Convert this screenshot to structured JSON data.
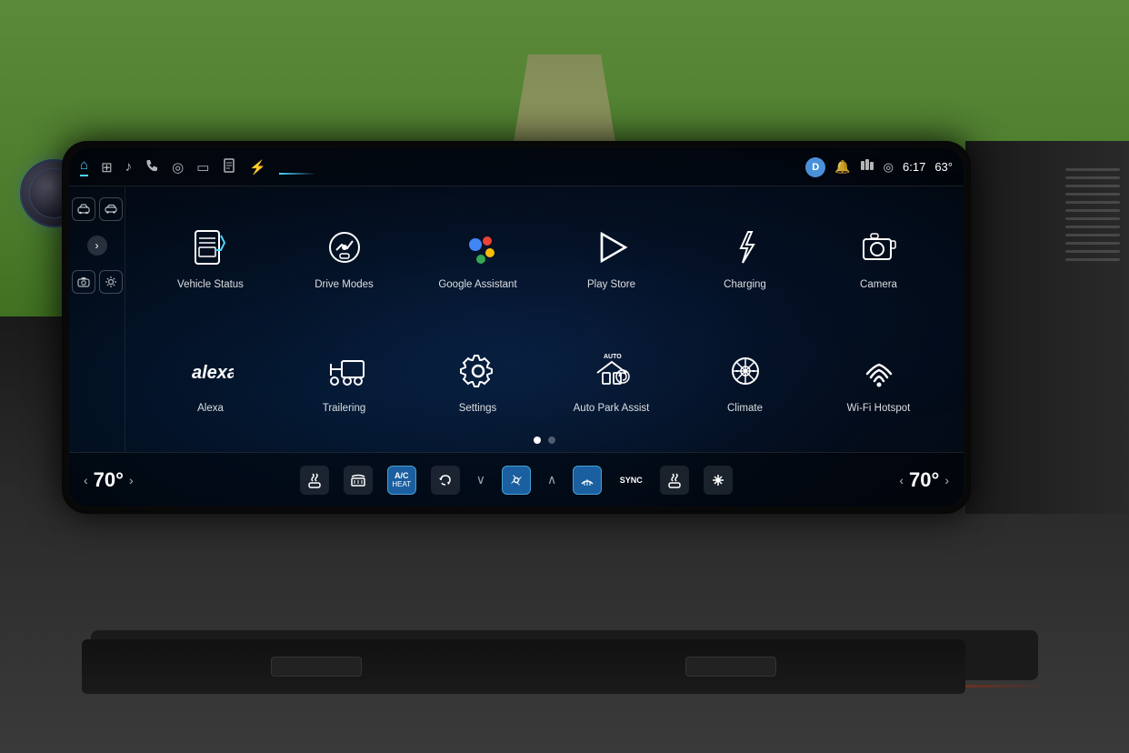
{
  "background": {
    "description": "outdoor scene with trees and dirt road"
  },
  "nav_bar": {
    "icons": [
      {
        "name": "home-icon",
        "symbol": "⌂",
        "active": true
      },
      {
        "name": "grid-icon",
        "symbol": "⊞"
      },
      {
        "name": "music-icon",
        "symbol": "♪"
      },
      {
        "name": "phone-icon",
        "symbol": "☎"
      },
      {
        "name": "location-icon",
        "symbol": "◎"
      },
      {
        "name": "phone2-icon",
        "symbol": "📱"
      },
      {
        "name": "doc-icon",
        "symbol": "📄"
      },
      {
        "name": "lightning-icon",
        "symbol": "⚡"
      }
    ],
    "right": {
      "avatar_label": "D",
      "bell_icon": "🔔",
      "map_icon": "⊞",
      "location_icon": "◎",
      "time": "6:17",
      "temp": "63°"
    }
  },
  "sidebar": {
    "icons": [
      {
        "name": "car-front-icon",
        "symbol": "🚗"
      },
      {
        "name": "car-side-icon",
        "symbol": "🚙"
      },
      {
        "name": "camera-icon",
        "symbol": "📷"
      },
      {
        "name": "sun-icon",
        "symbol": "☀"
      }
    ],
    "arrow": "›"
  },
  "apps": {
    "row1": [
      {
        "id": "vehicle-status",
        "label": "Vehicle Status",
        "icon_type": "document-chart"
      },
      {
        "id": "drive-modes",
        "label": "Drive Modes",
        "icon_type": "car-circle"
      },
      {
        "id": "google-assistant",
        "label": "Google Assistant",
        "icon_type": "google-dots"
      },
      {
        "id": "play-store",
        "label": "Play Store",
        "icon_type": "play-triangle"
      },
      {
        "id": "charging",
        "label": "Charging",
        "icon_type": "lightning"
      },
      {
        "id": "camera",
        "label": "Camera",
        "icon_type": "camera"
      }
    ],
    "row2": [
      {
        "id": "alexa",
        "label": "Alexa",
        "icon_type": "alexa-text"
      },
      {
        "id": "trailering",
        "label": "Trailering",
        "icon_type": "trailer"
      },
      {
        "id": "settings",
        "label": "Settings",
        "icon_type": "gear"
      },
      {
        "id": "auto-park",
        "label": "Auto Park Assist",
        "icon_type": "auto-park",
        "badge": "AUTO"
      },
      {
        "id": "climate",
        "label": "Climate",
        "icon_type": "fan"
      },
      {
        "id": "wifi-hotspot",
        "label": "Wi-Fi Hotspot",
        "icon_type": "wifi"
      }
    ]
  },
  "pagination": {
    "dots": [
      true,
      false
    ]
  },
  "climate": {
    "left_temp": "70°",
    "right_temp": "70°",
    "left_arrow_prev": "‹",
    "left_arrow_next": "›",
    "right_arrow_prev": "‹",
    "right_arrow_next": "›",
    "controls": [
      {
        "id": "seat-heat-left",
        "icon": "seat-heat",
        "active": false
      },
      {
        "id": "defrost-rear",
        "icon": "defrost",
        "active": false
      },
      {
        "id": "ac-heat",
        "label": "A/C\nHEAT",
        "active": true
      },
      {
        "id": "recirc",
        "icon": "recirc",
        "active": false
      },
      {
        "id": "fan-down",
        "icon": "chevron-down"
      },
      {
        "id": "fan",
        "icon": "fan",
        "active": true
      },
      {
        "id": "fan-up",
        "icon": "chevron-up"
      },
      {
        "id": "sync",
        "label": "SYNC",
        "active": true
      },
      {
        "id": "seat-heat-right",
        "icon": "seat-heat-right",
        "active": false
      },
      {
        "id": "seat-cool-right",
        "icon": "seat-cool",
        "active": false
      }
    ]
  }
}
